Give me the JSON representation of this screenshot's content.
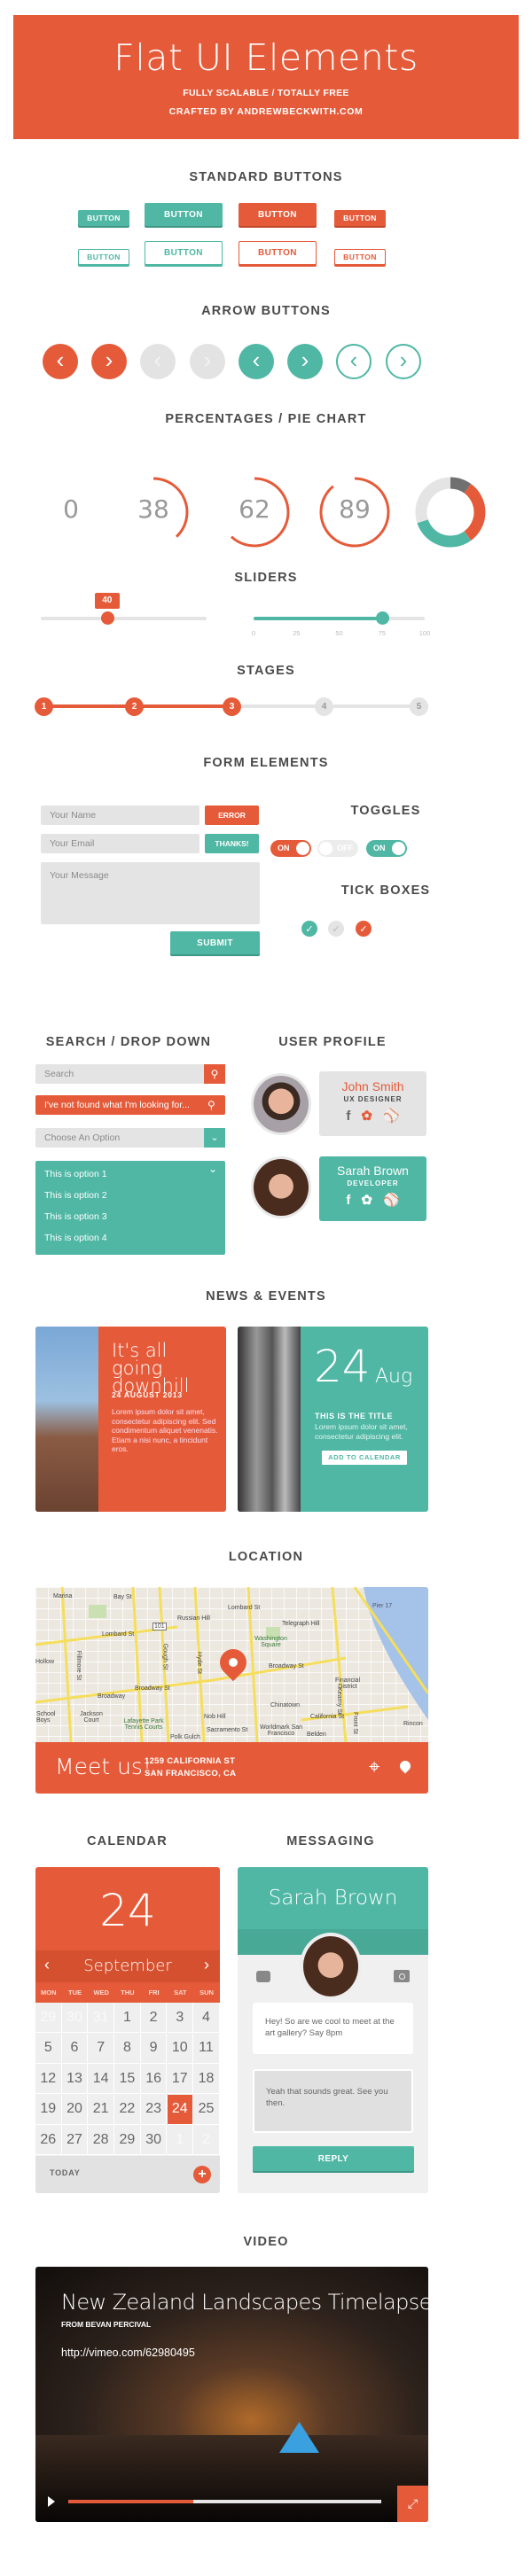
{
  "header": {
    "title": "Flat UI Elements",
    "subtitle": "FULLY SCALABLE / TOTALLY FREE",
    "credit": "CRAFTED BY  ANDREWBECKWITH.COM"
  },
  "colors": {
    "orange": "#e55b3a",
    "teal": "#4fb7a4",
    "light_gray": "#e4e4e4",
    "text": "#4a4a4a"
  },
  "standard_buttons": {
    "title": "STANDARD  BUTTONS",
    "label": "BUTTON"
  },
  "arrow_buttons": {
    "title": "ARROW  BUTTONS",
    "items": [
      {
        "icon": "chevron-left-icon",
        "style": "orange"
      },
      {
        "icon": "chevron-right-icon",
        "style": "orange"
      },
      {
        "icon": "chevron-left-icon",
        "style": "disabled"
      },
      {
        "icon": "chevron-right-icon",
        "style": "disabled"
      },
      {
        "icon": "chevron-left-icon",
        "style": "teal"
      },
      {
        "icon": "chevron-right-icon",
        "style": "teal"
      },
      {
        "icon": "chevron-left-icon",
        "style": "teal-outline"
      },
      {
        "icon": "chevron-right-icon",
        "style": "teal-outline"
      }
    ]
  },
  "percentages": {
    "title": "PERCENTAGES / PIE CHART",
    "values": [
      "0",
      "38",
      "62",
      "89"
    ],
    "pie_segments": [
      {
        "fraction": 0.1,
        "color": "#707070"
      },
      {
        "fraction": 0.3,
        "color": "#e55b3a"
      },
      {
        "fraction": 0.3,
        "color": "#4fb7a4"
      },
      {
        "fraction": 0.3,
        "color": "#e4e4e4"
      }
    ]
  },
  "sliders": {
    "title": "SLIDERS",
    "slider1": {
      "value": 40,
      "tooltip": "40"
    },
    "slider2": {
      "value": 75,
      "ticks": [
        "0",
        "25",
        "50",
        "75",
        "100"
      ]
    }
  },
  "stages": {
    "title": "STAGES",
    "steps": [
      "1",
      "2",
      "3",
      "4",
      "5"
    ],
    "current": 3
  },
  "form": {
    "title": "FORM  ELEMENTS",
    "name_placeholder": "Your Name",
    "error_label": "ERROR",
    "email_placeholder": "Your Email",
    "thanks_label": "THANKS!",
    "message_placeholder": "Your Message",
    "submit_label": "SUBMIT"
  },
  "toggles": {
    "title": "TOGGLES",
    "items": [
      {
        "label": "ON",
        "state": true
      },
      {
        "label": "OFF",
        "state": false
      },
      {
        "label": "ON",
        "state": true
      }
    ]
  },
  "tick_boxes": {
    "title": "TICK BOXES",
    "items": [
      {
        "checked": true,
        "color": "teal"
      },
      {
        "checked": false,
        "color": "gray"
      },
      {
        "checked": true,
        "color": "orange"
      }
    ]
  },
  "search": {
    "title": "SEARCH / DROP DOWN",
    "search_placeholder": "Search",
    "search_value": "I've not found what I'm looking for...",
    "select_placeholder": "Choose An Option",
    "options": [
      "This is option 1",
      "This is option 2",
      "This is option 3",
      "This is option 4"
    ]
  },
  "profile": {
    "title": "USER  PROFILE",
    "users": [
      {
        "name": "John Smith",
        "role": "UX DESIGNER"
      },
      {
        "name": "Sarah Brown",
        "role": "DEVELOPER"
      }
    ]
  },
  "news": {
    "title": "NEWS  &  EVENTS",
    "article": {
      "headline": "It's all going downhill",
      "date": "24 AUGUST 2013",
      "body": "Lorem ipsum dolor sit amet, consectetur adipiscing elit. Sed condimentum aliquet venenatis. Etiam a nisi nunc, a tincidunt eros."
    },
    "event": {
      "day": "24",
      "month": "Aug",
      "title": "THIS IS THE TITLE",
      "body": "Lorem ipsum dolor sit amet, consectetur adipiscing elit.",
      "button": "ADD TO CALENDAR"
    }
  },
  "location": {
    "title": "LOCATION",
    "cta": "Meet us!",
    "address_line1": "1259  CALIFORNIA ST",
    "address_line2": "SAN FRANCISCO, CA",
    "map_labels": [
      "Marina",
      "Bay St",
      "Lombard St",
      "Russian Hill",
      "101",
      "Lombard St",
      "Telegraph Hill",
      "Washington Square",
      "Broadway St",
      "Broadway",
      "Broadway St",
      "Financial District",
      "Chinatown",
      "California St",
      "Nob Hill",
      "Sacramento St",
      "Polk Gulch",
      "Lafayette Park Tennis Courts",
      "Jackson Court",
      "Pier 17",
      "Rincon",
      "Worldmark San Francisco",
      "Belden",
      "Fillmore St",
      "Gough St",
      "Hyde St",
      "Kearny St",
      "Front St",
      "School Boys",
      "Hollow"
    ]
  },
  "calendar": {
    "title": "CALENDAR",
    "day": "24",
    "month": "September",
    "weekdays": [
      "MON",
      "TUE",
      "WED",
      "THU",
      "FRI",
      "SAT",
      "SUN"
    ],
    "cells": [
      "29",
      "30",
      "31",
      "1",
      "2",
      "3",
      "4",
      "5",
      "6",
      "7",
      "8",
      "9",
      "10",
      "11",
      "12",
      "13",
      "14",
      "15",
      "16",
      "17",
      "18",
      "19",
      "20",
      "21",
      "22",
      "23",
      "24",
      "25",
      "26",
      "27",
      "28",
      "29",
      "30",
      "1",
      "2"
    ],
    "muted_indices": [
      0,
      1,
      2,
      33,
      34
    ],
    "selected": "24",
    "today_label": "TODAY"
  },
  "messaging": {
    "title": "MESSAGING",
    "contact": "Sarah Brown",
    "received": "Hey! So are we cool to meet at the art gallery? Say 8pm",
    "reply_value": "Yeah that sounds great. See you then.",
    "reply_button": "REPLY"
  },
  "video": {
    "title": "VIDEO",
    "video_title": "New Zealand Landscapes Timelapse",
    "author": "FROM BEVAN PERCIVAL",
    "url": "http://vimeo.com/62980495",
    "progress": 0.4
  }
}
